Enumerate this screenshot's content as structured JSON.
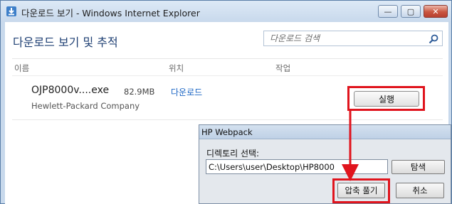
{
  "window": {
    "title": "다운로드 보기 - Windows Internet Explorer",
    "controls": {
      "minimize": "—",
      "maximize": "▢",
      "close": "✕"
    }
  },
  "downloads": {
    "heading": "다운로드 보기 및 추적",
    "search": {
      "placeholder": "다운로드 검색",
      "value": ""
    },
    "columns": {
      "name": "이름",
      "location": "위치",
      "action": "작업"
    },
    "items": [
      {
        "file_name": "OJP8000v....exe",
        "size": "82.9MB",
        "publisher": "Hewlett-Packard Company",
        "location": "다운로드",
        "action_label": "실행"
      }
    ]
  },
  "hp_dialog": {
    "title": "HP Webpack",
    "dir_label": "디렉토리 선택:",
    "path_value": "C:\\Users\\user\\Desktop\\HP8000",
    "browse_label": "탐색",
    "extract_label": "압축 풀기",
    "cancel_label": "취소"
  },
  "highlights": {
    "color": "#e0141d"
  },
  "colors": {
    "heading": "#1e3f73",
    "link": "#1b65c4"
  },
  "icons": {
    "app": "ie-download-icon",
    "search": "search-icon"
  }
}
